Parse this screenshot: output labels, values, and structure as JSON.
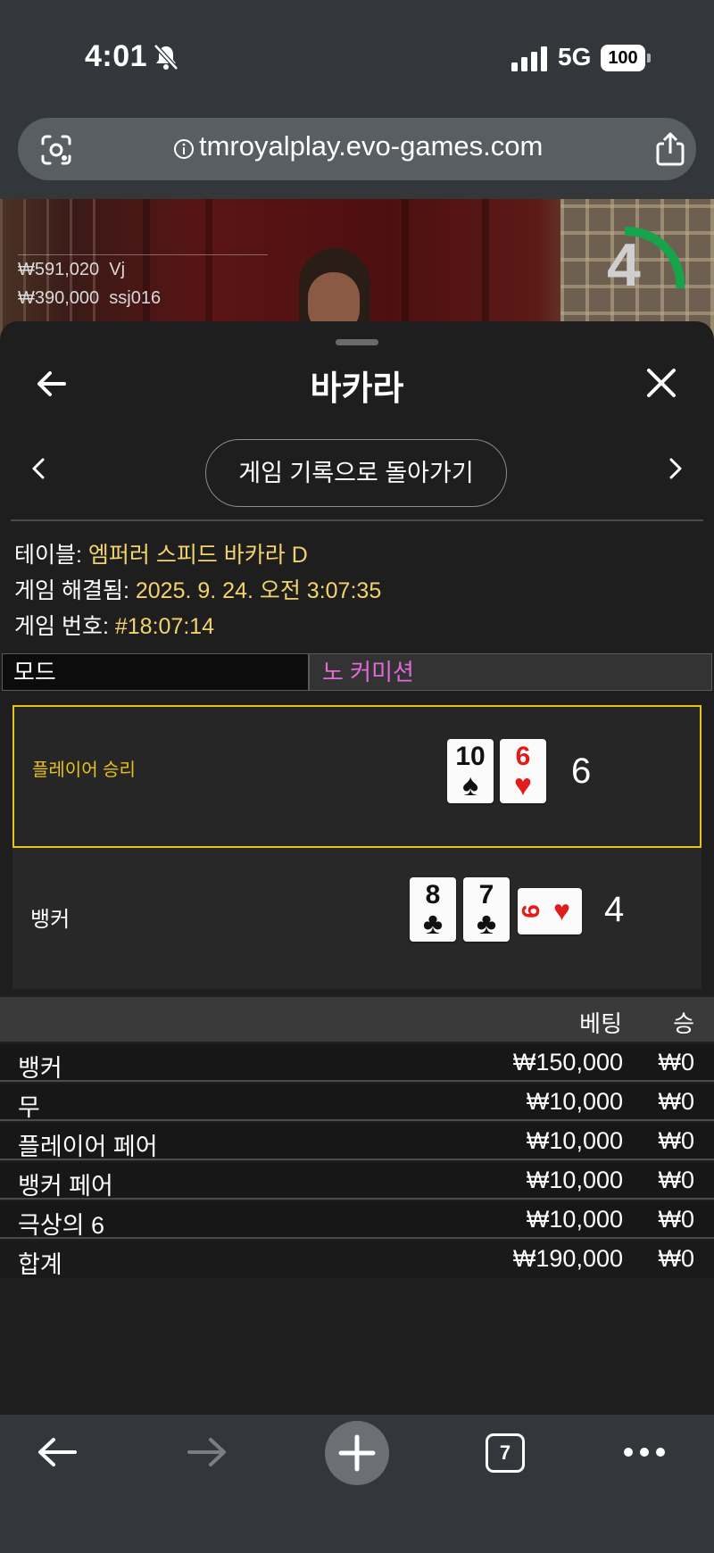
{
  "status_bar": {
    "time": "4:01",
    "network": "5G",
    "battery": "100"
  },
  "browser": {
    "url": "tmroyalplay.evo-games.com",
    "tab_count": "7"
  },
  "video": {
    "overlay_rows": [
      {
        "amount": "₩591,020",
        "user": "Vj"
      },
      {
        "amount": "₩390,000",
        "user": "ssj016"
      }
    ],
    "countdown": "4"
  },
  "panel": {
    "title": "바카라",
    "history_button": "게임 기록으로 돌아가기",
    "table_label": "테이블:",
    "table_value": "엠퍼러 스피드 바카라 D",
    "resolved_label": "게임 해결됨:",
    "resolved_value": "2025. 9. 24. 오전 3:07:35",
    "game_no_label": "게임 번호:",
    "game_no_value": "#18:07:14",
    "mode_label": "모드",
    "mode_value": "노 커미션"
  },
  "result": {
    "player": {
      "label": "플레이어 승리",
      "score": "6",
      "cards": [
        {
          "rank": "10",
          "suit": "♠",
          "color": "#111111"
        },
        {
          "rank": "6",
          "suit": "♥",
          "color": "#e21b1b"
        }
      ]
    },
    "banker": {
      "label": "뱅커",
      "score": "4",
      "cards": [
        {
          "rank": "8",
          "suit": "♣",
          "color": "#111111"
        },
        {
          "rank": "7",
          "suit": "♣",
          "color": "#111111"
        },
        {
          "rank": "9",
          "suit": "♥",
          "color": "#e21b1b",
          "sideways": true
        }
      ]
    },
    "accent_color": "#e8c11a"
  },
  "bets": {
    "col_bet": "베팅",
    "col_win": "승",
    "rows": [
      {
        "name": "뱅커",
        "bet": "₩150,000",
        "win": "₩0"
      },
      {
        "name": "무",
        "bet": "₩10,000",
        "win": "₩0"
      },
      {
        "name": "플레이어 페어",
        "bet": "₩10,000",
        "win": "₩0"
      },
      {
        "name": "뱅커 페어",
        "bet": "₩10,000",
        "win": "₩0"
      },
      {
        "name": "극상의 6",
        "bet": "₩10,000",
        "win": "₩0"
      }
    ],
    "total": {
      "name": "합계",
      "bet": "₩190,000",
      "win": "₩0"
    }
  }
}
